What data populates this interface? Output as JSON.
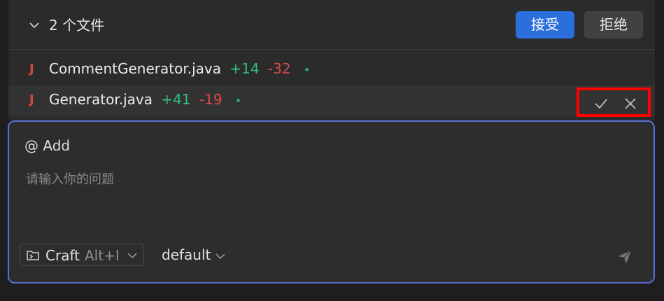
{
  "header": {
    "file_count": "2 个文件",
    "accept_label": "接受",
    "reject_label": "拒绝"
  },
  "files": [
    {
      "icon": "J",
      "name": "CommentGenerator.java",
      "added": "+14",
      "removed": "-32"
    },
    {
      "icon": "J",
      "name": "Generator.java",
      "added": "+41",
      "removed": "-19"
    }
  ],
  "composer": {
    "mention_label": "@ Add",
    "placeholder": "请输入你的问题",
    "mode_label": "Craft",
    "mode_shortcut": "Alt+I",
    "model_label": "default"
  },
  "colors": {
    "accent": "#2a6fdb",
    "added": "#2ec27e",
    "removed": "#e04a4a",
    "highlight_box": "#ff0000"
  },
  "icons": [
    "chevron-down-icon",
    "java-file-icon",
    "check-icon",
    "close-icon",
    "terminal-icon",
    "send-icon"
  ]
}
